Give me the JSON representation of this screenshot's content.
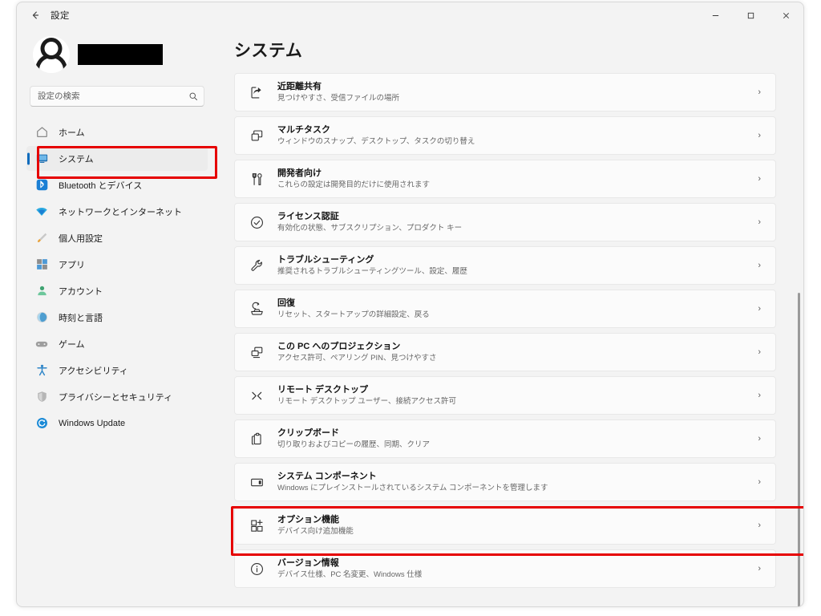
{
  "window": {
    "app_title": "設定",
    "back_icon": "back-arrow-icon",
    "controls": {
      "minimize": "–",
      "maximize": "□",
      "close": "✕"
    }
  },
  "sidebar": {
    "account": {
      "avatar_icon": "user-avatar-icon",
      "name_redacted": true
    },
    "search": {
      "placeholder": "設定の検索",
      "value": "",
      "icon": "search-icon"
    },
    "items": [
      {
        "label": "ホーム",
        "icon": "home-icon",
        "selected": false
      },
      {
        "label": "システム",
        "icon": "monitor-icon",
        "selected": true
      },
      {
        "label": "Bluetooth とデバイス",
        "icon": "bluetooth-icon",
        "selected": false
      },
      {
        "label": "ネットワークとインターネット",
        "icon": "wifi-icon",
        "selected": false
      },
      {
        "label": "個人用設定",
        "icon": "brush-icon",
        "selected": false
      },
      {
        "label": "アプリ",
        "icon": "apps-icon",
        "selected": false
      },
      {
        "label": "アカウント",
        "icon": "person-icon",
        "selected": false
      },
      {
        "label": "時刻と言語",
        "icon": "clock-globe-icon",
        "selected": false
      },
      {
        "label": "ゲーム",
        "icon": "gamepad-icon",
        "selected": false
      },
      {
        "label": "アクセシビリティ",
        "icon": "accessibility-icon",
        "selected": false
      },
      {
        "label": "プライバシーとセキュリティ",
        "icon": "shield-icon",
        "selected": false
      },
      {
        "label": "Windows Update",
        "icon": "update-icon",
        "selected": false
      }
    ]
  },
  "main": {
    "page_title": "システム",
    "chevron": "›",
    "cards": [
      {
        "title": "近距離共有",
        "subtitle": "見つけやすさ、受信ファイルの場所",
        "icon": "share-icon"
      },
      {
        "title": "マルチタスク",
        "subtitle": "ウィンドウのスナップ、デスクトップ、タスクの切り替え",
        "icon": "multitask-icon"
      },
      {
        "title": "開発者向け",
        "subtitle": "これらの設定は開発目的だけに使用されます",
        "icon": "dev-tools-icon"
      },
      {
        "title": "ライセンス認証",
        "subtitle": "有効化の状態、サブスクリプション、プロダクト キー",
        "icon": "check-circle-icon"
      },
      {
        "title": "トラブルシューティング",
        "subtitle": "推奨されるトラブルシューティングツール、設定、履歴",
        "icon": "wrench-icon"
      },
      {
        "title": "回復",
        "subtitle": "リセット、スタートアップの詳細設定、戻る",
        "icon": "recovery-icon"
      },
      {
        "title": "この PC へのプロジェクション",
        "subtitle": "アクセス許可、ペアリング PIN、見つけやすさ",
        "icon": "projection-icon"
      },
      {
        "title": "リモート デスクトップ",
        "subtitle": "リモート デスクトップ ユーザー、接続アクセス許可",
        "icon": "remote-desktop-icon"
      },
      {
        "title": "クリップボード",
        "subtitle": "切り取りおよびコピーの履歴、同期、クリア",
        "icon": "clipboard-icon"
      },
      {
        "title": "システム コンポーネント",
        "subtitle": "Windows にプレインストールされているシステム コンポーネントを管理します",
        "icon": "component-icon"
      },
      {
        "title": "オプション機能",
        "subtitle": "デバイス向け追加機能",
        "icon": "optional-features-icon"
      },
      {
        "title": "バージョン情報",
        "subtitle": "デバイス仕様、PC 名変更、Windows 仕様",
        "icon": "info-icon"
      }
    ]
  },
  "annotations": {
    "highlight_color": "#e60000",
    "boxes": [
      {
        "target": "sidebar-item-system"
      },
      {
        "target": "card-optional-features"
      }
    ]
  }
}
